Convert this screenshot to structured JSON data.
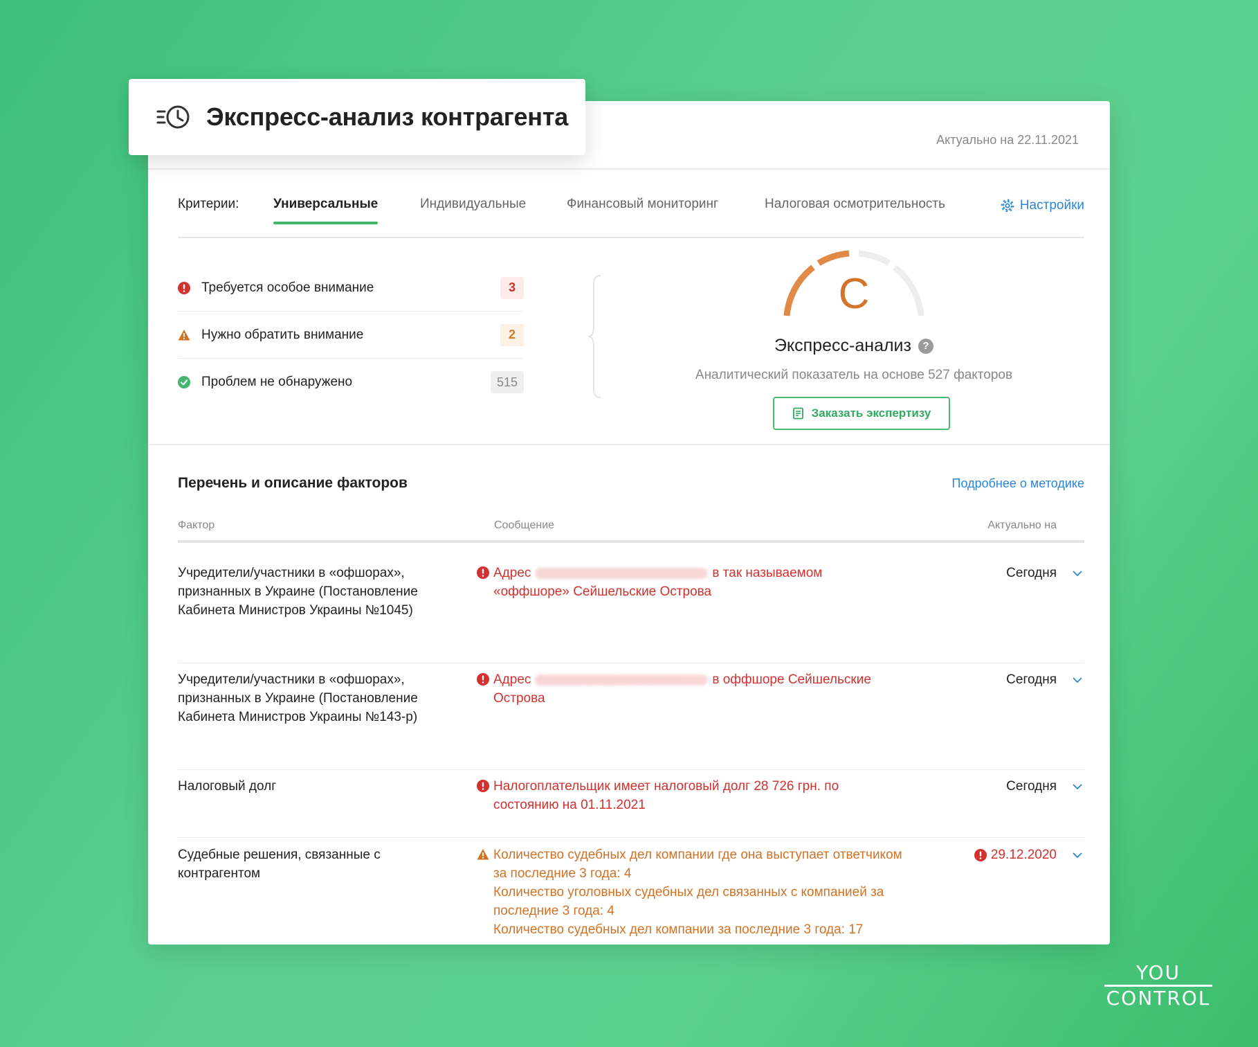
{
  "header": {
    "title": "Экспресс-анализ контрагента",
    "actual_date": "Актуально на 22.11.2021"
  },
  "criteria": {
    "label": "Критерии:",
    "tabs": [
      "Универсальные",
      "Индивидуальные",
      "Финансовый мониторинг",
      "Налоговая осмотрительность"
    ],
    "active_tab": "Универсальные",
    "settings_label": "Настройки"
  },
  "summary": [
    {
      "label": "Требуется особое внимание",
      "count": "3",
      "status": "critical"
    },
    {
      "label": "Нужно обратить внимание",
      "count": "2",
      "status": "warning"
    },
    {
      "label": "Проблем не обнаружено",
      "count": "515",
      "status": "ok"
    }
  ],
  "score": {
    "grade": "C",
    "title": "Экспресс-анализ",
    "help_icon": "?",
    "subtitle": "Аналитический показатель на основе 527 факторов",
    "order_button": "Заказать экспертизу"
  },
  "factors_section": {
    "title": "Перечень и описание факторов",
    "method_link": "Подробнее о методике",
    "columns": [
      "Фактор",
      "Сообщение",
      "Актуально на"
    ]
  },
  "rows": [
    {
      "factor": "Учредители/участники в «офшорах», признанных в Украине (Постановление Кабинета Министров Украины №1045)",
      "msg_before": "Адрес",
      "msg_after": "в так называемом «оффшоре» Сейшельские Острова",
      "date": "Сегодня"
    },
    {
      "factor": "Учредители/участники в «офшорах», признанных в Украине (Постановление Кабинета Министров Украины №143-р)",
      "msg_before": "Адрес",
      "msg_after": "в оффшоре Сейшельские Острова",
      "date": "Сегодня"
    },
    {
      "factor": "Налоговый долг",
      "msg": "Налогоплательщик имеет налоговый долг 28 726 грн. по состоянию на 01.11.2021",
      "date": "Сегодня"
    },
    {
      "factor": "Судебные решения, связанные с контрагентом",
      "msg_lines": [
        "Количество судебных дел компании где она выступает ответчиком за последние 3 года: 4",
        "Количество уголовных судебных дел связанных с компанией за последние 3 года: 4",
        "Количество судебных дел компании за последние 3 года: 17"
      ],
      "date": "29.12.2020"
    }
  ],
  "colors": {
    "accent_green": "#43b66b",
    "link_blue": "#2b87d6",
    "critical_red": "#d2312f",
    "warning_orange": "#d27225",
    "grade_orange": "#d2742a"
  },
  "brand": {
    "logo_top": "YOU",
    "logo_bottom": "CONTROL"
  }
}
